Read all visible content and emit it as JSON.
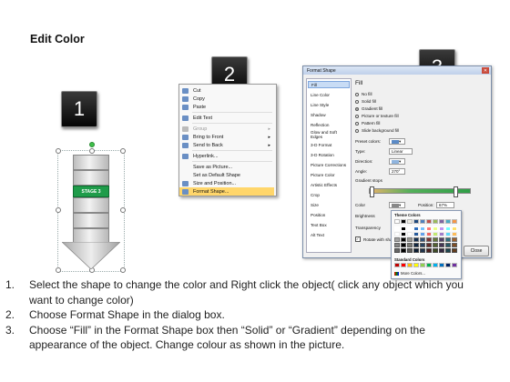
{
  "title": "Edit Color",
  "steps": [
    "1",
    "2",
    "3"
  ],
  "shape": {
    "stage_label": "STAGE 3"
  },
  "context_menu": {
    "items": [
      {
        "label": "Cut"
      },
      {
        "label": "Copy"
      },
      {
        "label": "Paste"
      },
      {
        "label": "Edit Text"
      },
      {
        "label": "Group"
      },
      {
        "label": "Bring to Front"
      },
      {
        "label": "Send to Back"
      },
      {
        "label": "Hyperlink..."
      },
      {
        "label": "Save as Picture..."
      },
      {
        "label": "Set as Default Shape"
      },
      {
        "label": "Size and Position..."
      },
      {
        "label": "Format Shape..."
      }
    ]
  },
  "dialog": {
    "title": "Format Shape",
    "categories": [
      "Fill",
      "Line Color",
      "Line Style",
      "Shadow",
      "Reflection",
      "Glow and Soft Edges",
      "3-D Format",
      "3-D Rotation",
      "Picture Corrections",
      "Picture Color",
      "Artistic Effects",
      "Crop",
      "Size",
      "Position",
      "Text Box",
      "Alt Text"
    ],
    "fill_heading": "Fill",
    "options": [
      "No fill",
      "Solid fill",
      "Gradient fill",
      "Picture or texture fill",
      "Pattern fill",
      "Slide background fill"
    ],
    "preset_colors_label": "Preset colors:",
    "type_label": "Type:",
    "type_value": "Linear",
    "direction_label": "Direction:",
    "angle_label": "Angle:",
    "angle_value": "270°",
    "gradient_stops_label": "Gradient stops",
    "color_label": "Color",
    "position_label": "Position:",
    "position_value": "67%",
    "brightness_label": "Brightness",
    "transparency_label": "Transparency",
    "rotate_label": "Rotate with shape",
    "theme_colors_label": "Theme Colors",
    "standard_colors_label": "Standard Colors",
    "more_colors_label": "More Colors...",
    "close_label": "Close"
  },
  "instructions": [
    {
      "num": "1.",
      "line1": "Select the shape to change the color and Right click the object( click any object which you",
      "line2": "want to change color)"
    },
    {
      "num": "2.",
      "line1": "Choose Format Shape in the dialog box.",
      "line2": ""
    },
    {
      "num": "3.",
      "line1": "Choose “Fill” in the Format Shape box then “Solid” or “Gradient” depending on the",
      "line2": "appearance of the object. Change colour as shown in the picture."
    }
  ],
  "colors": {
    "highlight": "#ffd66b",
    "stage_green": "#1f9c4a",
    "badge": "#111111"
  }
}
